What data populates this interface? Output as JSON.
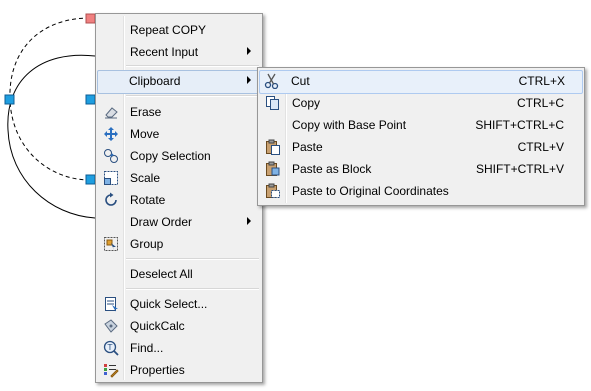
{
  "context_menu": {
    "items": [
      {
        "label": "Repeat COPY"
      },
      {
        "label": "Recent Input"
      },
      {
        "label": "Clipboard"
      },
      {
        "label": "Erase"
      },
      {
        "label": "Move"
      },
      {
        "label": "Copy Selection"
      },
      {
        "label": "Scale"
      },
      {
        "label": "Rotate"
      },
      {
        "label": "Draw Order"
      },
      {
        "label": "Group"
      },
      {
        "label": "Deselect All"
      },
      {
        "label": "Quick Select..."
      },
      {
        "label": "QuickCalc"
      },
      {
        "label": "Find..."
      },
      {
        "label": "Properties"
      }
    ]
  },
  "clipboard_submenu": {
    "items": [
      {
        "label": "Cut",
        "shortcut": "CTRL+X"
      },
      {
        "label": "Copy",
        "shortcut": "CTRL+C"
      },
      {
        "label": "Copy with Base Point",
        "shortcut": "SHIFT+CTRL+C"
      },
      {
        "label": "Paste",
        "shortcut": "CTRL+V"
      },
      {
        "label": "Paste as Block",
        "shortcut": "SHIFT+CTRL+V"
      },
      {
        "label": "Paste to Original Coordinates",
        "shortcut": ""
      }
    ]
  },
  "colors": {
    "grip": "#1e9ee0",
    "grip_hot": "#f08080",
    "highlight": "#e6eef8"
  }
}
